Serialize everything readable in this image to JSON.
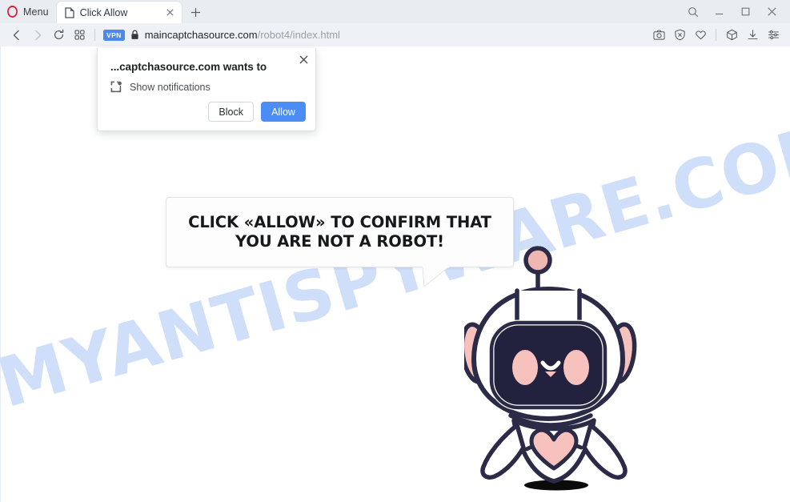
{
  "browser": {
    "menu_label": "Menu",
    "menu_icon": "opera-logo-icon",
    "tabs": [
      {
        "title": "Click Allow",
        "favicon": "document-icon",
        "close_icon": "close-icon"
      }
    ],
    "new_tab_icon": "plus-icon",
    "window_controls": [
      {
        "name": "search-icon",
        "label": "Search"
      },
      {
        "name": "minimize-icon",
        "label": "Minimize"
      },
      {
        "name": "maximize-icon",
        "label": "Maximize"
      },
      {
        "name": "close-icon",
        "label": "Close"
      }
    ],
    "nav": {
      "back_icon": "back-arrow-icon",
      "forward_icon": "forward-arrow-icon",
      "reload_icon": "reload-icon",
      "speeddial_icon": "grid-icon"
    },
    "address": {
      "vpn_badge": "VPN",
      "lock_icon": "lock-icon",
      "domain": "maincaptchasource.com",
      "path": "/robot4/index.html",
      "full_url": "maincaptchasource.com/robot4/index.html"
    },
    "toolbar_right": [
      {
        "name": "snapshot-icon",
        "label": "Snapshot"
      },
      {
        "name": "adblock-shield-icon",
        "label": "Ad blocker"
      },
      {
        "name": "heart-icon",
        "label": "Add to favorites"
      },
      {
        "name": "crypto-wallet-icon",
        "label": "Crypto Wallet"
      },
      {
        "name": "downloads-icon",
        "label": "Downloads"
      },
      {
        "name": "easy-setup-icon",
        "label": "Easy setup"
      }
    ]
  },
  "notification_popup": {
    "title": "...captchasource.com wants to",
    "permission_icon": "notifications-icon",
    "permission_label": "Show notifications",
    "block_label": "Block",
    "allow_label": "Allow",
    "close_icon": "close-icon",
    "allow_color": "#4b8cf5"
  },
  "page": {
    "watermark": "MYANTISPYWARE.COM",
    "watermark_color": "#cfdff9",
    "bubble_text": "CLICK «ALLOW» TO CONFIRM THAT YOU ARE NOT A ROBOT!",
    "robot": {
      "name": "robot-mascot",
      "outline_color": "#2b2b48",
      "accent_color": "#f7c2bd",
      "shadow_color": "#0b0b0b"
    }
  }
}
